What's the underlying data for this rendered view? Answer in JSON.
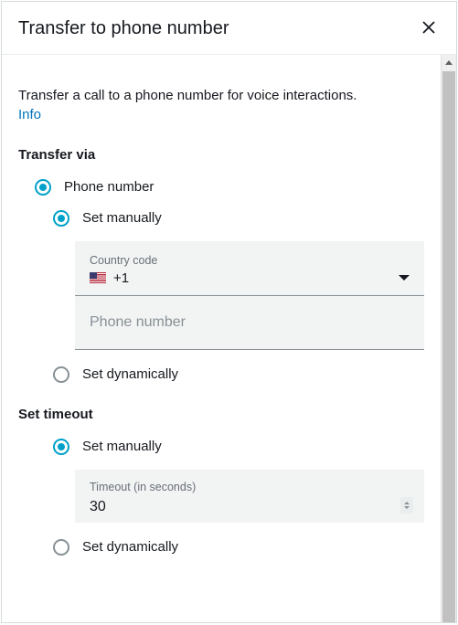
{
  "header": {
    "title": "Transfer to phone number"
  },
  "description": "Transfer a call to a phone number for voice interactions.",
  "info_link": "Info",
  "transfer_via": {
    "title": "Transfer via",
    "options": {
      "phone_number": "Phone number",
      "set_manually": "Set manually",
      "set_dynamically": "Set dynamically"
    },
    "country_code": {
      "label": "Country code",
      "value": "+1"
    },
    "phone_input": {
      "placeholder": "Phone number"
    }
  },
  "set_timeout": {
    "title": "Set timeout",
    "options": {
      "set_manually": "Set manually",
      "set_dynamically": "Set dynamically"
    },
    "timeout": {
      "label": "Timeout (in seconds)",
      "value": "30"
    }
  }
}
